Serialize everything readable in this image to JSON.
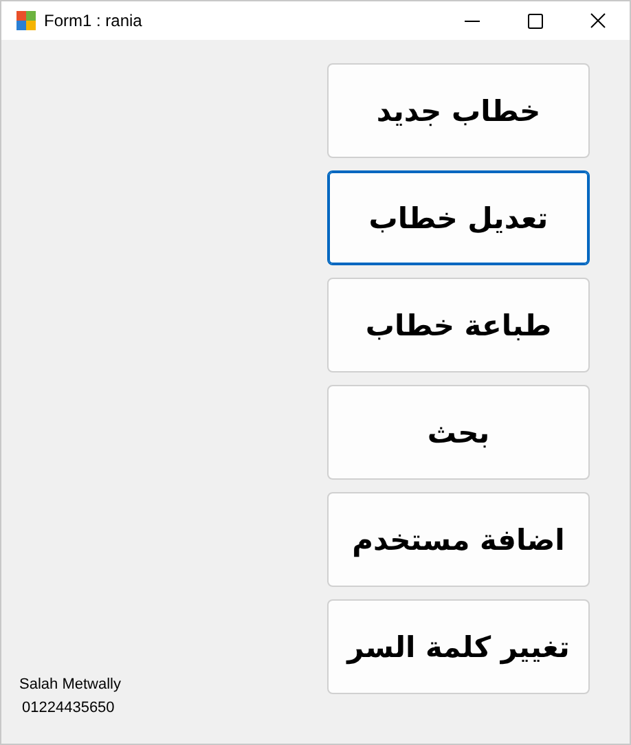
{
  "window": {
    "title": "Form1 : rania"
  },
  "buttons": [
    {
      "label": "خطاب جديد",
      "focused": false
    },
    {
      "label": "تعديل خطاب",
      "focused": true
    },
    {
      "label": "طباعة خطاب",
      "focused": false
    },
    {
      "label": "بحث",
      "focused": false
    },
    {
      "label": "اضافة مستخدم",
      "focused": false
    },
    {
      "label": "تغيير كلمة السر",
      "focused": false
    }
  ],
  "footer": [
    "Salah Metwally",
    "01224435650"
  ]
}
